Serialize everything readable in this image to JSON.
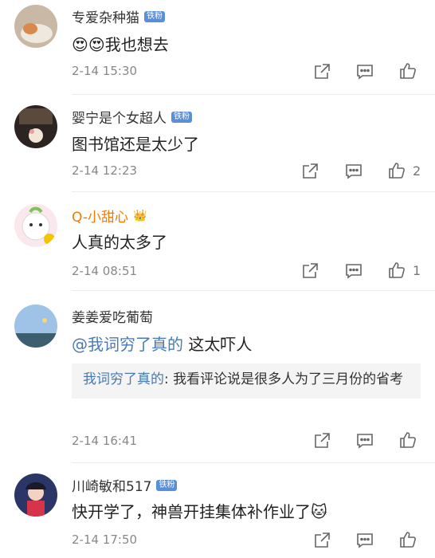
{
  "comments": [
    {
      "name": "专爱杂种猫",
      "badge": "铁粉",
      "text": "😍😍我也想去",
      "time": "2-14 15:30",
      "likes": ""
    },
    {
      "name": "婴宁是个女超人",
      "badge": "铁粉",
      "text": "图书馆还是太少了",
      "time": "2-14 12:23",
      "likes": "2"
    },
    {
      "name": "Q-小甜心",
      "badge": "👑",
      "text": "人真的太多了",
      "time": "2-14 08:51",
      "likes": "1"
    },
    {
      "name": "姜姜爱吃葡萄",
      "badge": "",
      "mention": "@我词穷了真的",
      "text": " 这太吓人",
      "quote_name": "我词穷了真的",
      "quote_text": ": 我看评论说是很多人为了三月份的省考",
      "time": "2-14 16:41",
      "likes": ""
    },
    {
      "name": "川崎敏和517",
      "badge": "铁粉",
      "text": "快开学了，神兽开挂集体补作业了🐱",
      "time": "2-14 17:50",
      "likes": ""
    }
  ],
  "icons": {
    "share": "share-icon",
    "comment": "comment-icon",
    "like": "like-icon"
  }
}
